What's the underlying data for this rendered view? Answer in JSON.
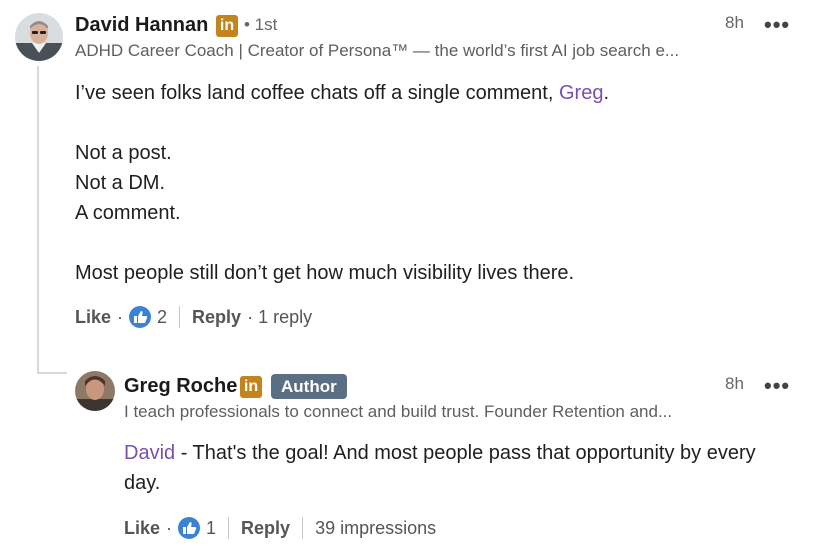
{
  "comment": {
    "author": "David Hannan",
    "badge": "in",
    "degree": "• 1st",
    "headline": "ADHD Career Coach | Creator of Persona™ — the world’s first AI job search e...",
    "time": "8h",
    "more": "•••",
    "lines": {
      "l1_pre": "I’ve seen folks land coffee chats off a single comment, ",
      "l1_mention": "Greg",
      "l1_post": ".",
      "l2": "Not a post.",
      "l3": "Not a DM.",
      "l4": "A comment.",
      "l5": "Most people still don’t get how much visibility lives there."
    },
    "actions": {
      "like": "Like",
      "sep": "·",
      "like_count": "2",
      "reply": "Reply",
      "reply_count": "· 1 reply"
    }
  },
  "reply": {
    "author": "Greg Roche",
    "badge": "in",
    "author_tag": "Author",
    "headline": "I teach professionals to connect and build trust. Founder Retention and...",
    "time": "8h",
    "more": "•••",
    "mention": "David",
    "text_line1": " - That's the goal! And most people pass that opportunity by every",
    "text_line2": "day.",
    "actions": {
      "like": "Like",
      "sep": "·",
      "like_count": "1",
      "reply": "Reply",
      "impressions": "39 impressions"
    }
  },
  "colors": {
    "linkedin_badge": "#c4841d",
    "mention": "#7a4fb3",
    "like_blue": "#3b82d6",
    "author_badge": "#5a6f84"
  }
}
